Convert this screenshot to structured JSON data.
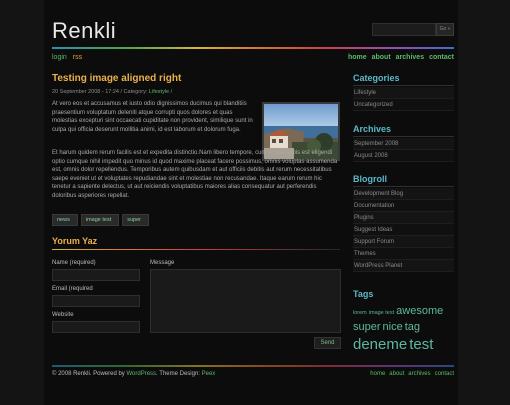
{
  "header": {
    "logo": "Renkli",
    "search_button": "Go »"
  },
  "topnav": {
    "login": "login",
    "rss": "rss",
    "links": [
      "home",
      "about",
      "archives",
      "contact"
    ]
  },
  "post": {
    "title": "Testing image aligned right",
    "meta_prefix": "20 September 2008 - 17:24 / Category: ",
    "category": "Lifestyle",
    "meta_suffix": " /",
    "para1": "At vero eos et accusamus et iusto odio dignissimos ducimus qui blanditiis praesentium voluptatum deleniti atque corrupti quos dolores et quas molestias excepturi sint occaecati cupiditate non provident, similique sunt in culpa qui officia deserunt mollitia animi, id est laborum et dolorum fuga.",
    "para2": "Et harum quidem rerum facilis est et expedita distinctio.Nam libero tempore, cum soluta nobis est eligendi optio cumque nihil impedit quo minus id quod maxime placeat facere possimus, omnis voluptas assumenda est, omnis dolor repellendus. Temporibus autem quibusdam et aut officiis debitis aut rerum necessitatibus saepe eveniet ut et voluptates repudiandae sint et molestiae non recusandae. Itaque earum rerum hic tenetur a sapiente delectus, ut aut reiciendis voluptatibus maiores alias consequatur aut perferendis doloribus asperiores repellat.",
    "tags": [
      "news",
      "image test",
      "super"
    ]
  },
  "comment_form": {
    "title": "Yorum Yaz",
    "name_label": "Name (required)",
    "email_label": "Email (required",
    "website_label": "Website",
    "message_label": "Message",
    "send_label": "Send"
  },
  "sidebar": {
    "categories": {
      "title": "Categories",
      "items": [
        "Lifestyle",
        "Uncategorized"
      ]
    },
    "archives": {
      "title": "Archives",
      "items": [
        "September 2008",
        "August 2008"
      ]
    },
    "blogroll": {
      "title": "Blogroll",
      "items": [
        "Development Blog",
        "Documentation",
        "Plugins",
        "Suggest Ideas",
        "Support Forum",
        "Themes",
        "WordPress Planet"
      ]
    },
    "tags": {
      "title": "Tags",
      "cloud": [
        "lorem",
        "image test",
        "awesome",
        "super",
        "nice",
        "tag",
        "deneme",
        "test"
      ]
    }
  },
  "footer": {
    "copyright": "© 2008 Renkli. Powered by ",
    "wordpress": "WordPress",
    "theme_design": ". Theme Design: ",
    "designer": "Peex",
    "links": [
      "home",
      "about",
      "archives",
      "contact"
    ]
  },
  "colors": {
    "accent_orange": "#eab04c",
    "accent_green": "#5db86d",
    "accent_cyan": "#5db8c9"
  }
}
